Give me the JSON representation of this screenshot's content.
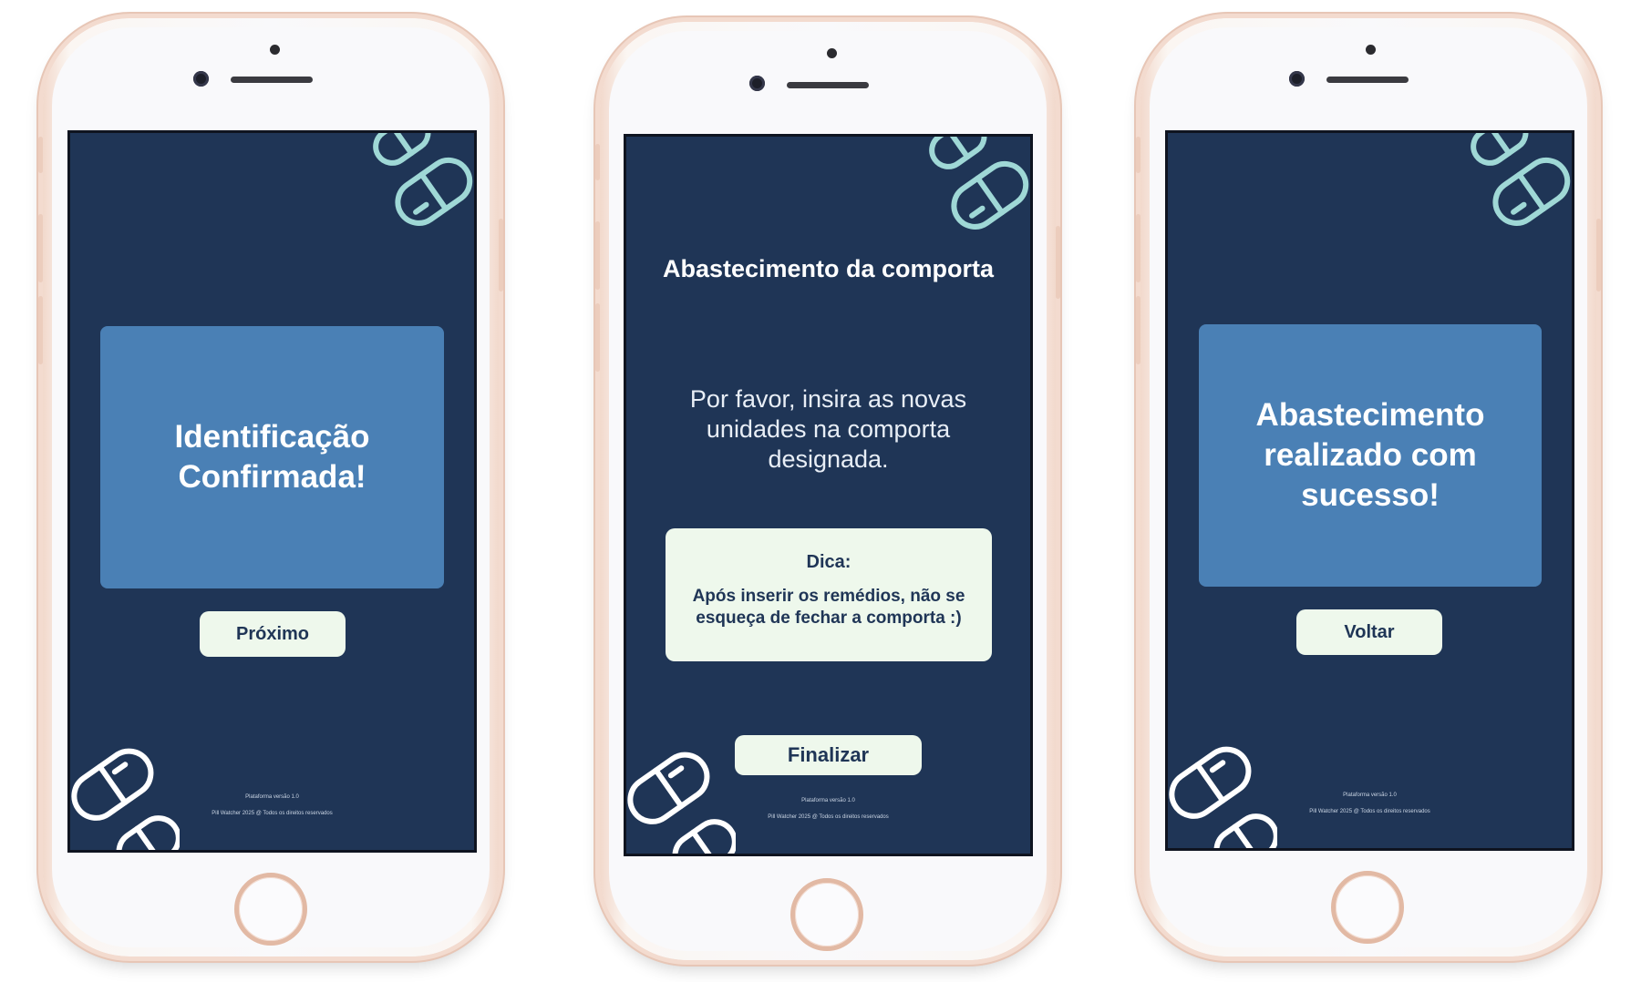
{
  "screens": [
    {
      "card_title": "Identificação Confirmada!",
      "button_label": "Próximo",
      "footer_version": "Plataforma versão 1.0",
      "footer_copyright": "Pill Watcher 2025 @ Todos os direitos reservados"
    },
    {
      "title": "Abastecimento da comporta",
      "instruction": "Por favor, insira as novas unidades na comporta designada.",
      "tip_heading": "Dica:",
      "tip_text": "Após inserir os remédios, não se esqueça de fechar a comporta :)",
      "button_label": "Finalizar",
      "footer_version": "Plataforma versão 1.0",
      "footer_copyright": "Pill Watcher 2025 @ Todos os direitos reservados"
    },
    {
      "card_title": "Abastecimento realizado com sucesso!",
      "button_label": "Voltar",
      "footer_version": "Plataforma versão 1.0",
      "footer_copyright": "Pill Watcher 2025 @ Todos os direitos reservados"
    }
  ],
  "colors": {
    "screen_bg": "#1f3556",
    "card_bg": "#4a80b5",
    "button_bg": "#eef8ec",
    "pill_stroke": "#9fd8d6"
  },
  "icons": [
    "pill-icon",
    "home-button-icon"
  ]
}
